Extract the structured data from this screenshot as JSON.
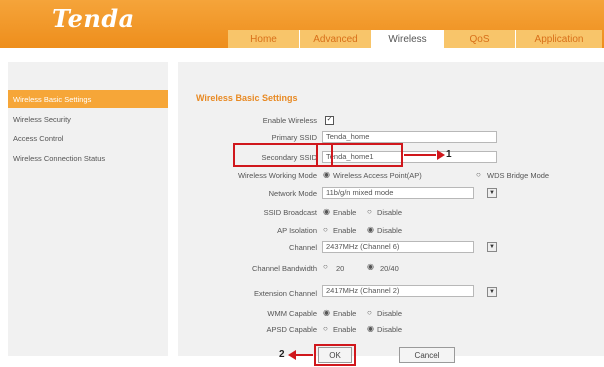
{
  "brand": {
    "logo": "Tenda"
  },
  "nav": {
    "tabs": [
      "Home",
      "Advanced",
      "Wireless",
      "QoS",
      "Application"
    ]
  },
  "sidebar": {
    "items": [
      "Wireless Basic Settings",
      "Wireless Security",
      "Access Control",
      "Wireless Connection Status"
    ]
  },
  "page": {
    "title": "Wireless Basic Settings"
  },
  "form": {
    "enable_wireless_label": "Enable Wireless",
    "primary_ssid_label": "Primary SSID",
    "primary_ssid_value": "Tenda_home",
    "secondary_ssid_label": "Secondary SSID",
    "secondary_ssid_value": "Tenda_home1",
    "working_mode_label": "Wireless Working Mode",
    "working_mode_opt1": "Wireless Access Point(AP)",
    "working_mode_opt2": "WDS Bridge Mode",
    "network_mode_label": "Network Mode",
    "network_mode_value": "11b/g/n mixed mode",
    "ssid_broadcast_label": "SSID Broadcast",
    "ap_isolation_label": "AP Isolation",
    "channel_label": "Channel",
    "channel_value": "2437MHz (Channel 6)",
    "bandwidth_label": "Channel Bandwidth",
    "bandwidth_opt1": "20",
    "bandwidth_opt2": "20/40",
    "ext_channel_label": "Extension Channel",
    "ext_channel_value": "2417MHz (Channel 2)",
    "wmm_label": "WMM Capable",
    "apsd_label": "APSD Capable",
    "enable_text": "Enable",
    "disable_text": "Disable"
  },
  "buttons": {
    "ok": "OK",
    "cancel": "Cancel"
  },
  "annotations": {
    "step1": "1",
    "step2": "2"
  },
  "colors": {
    "header": "#ee8e1c",
    "accent": "#e88a24",
    "annotation": "#d0171c"
  }
}
